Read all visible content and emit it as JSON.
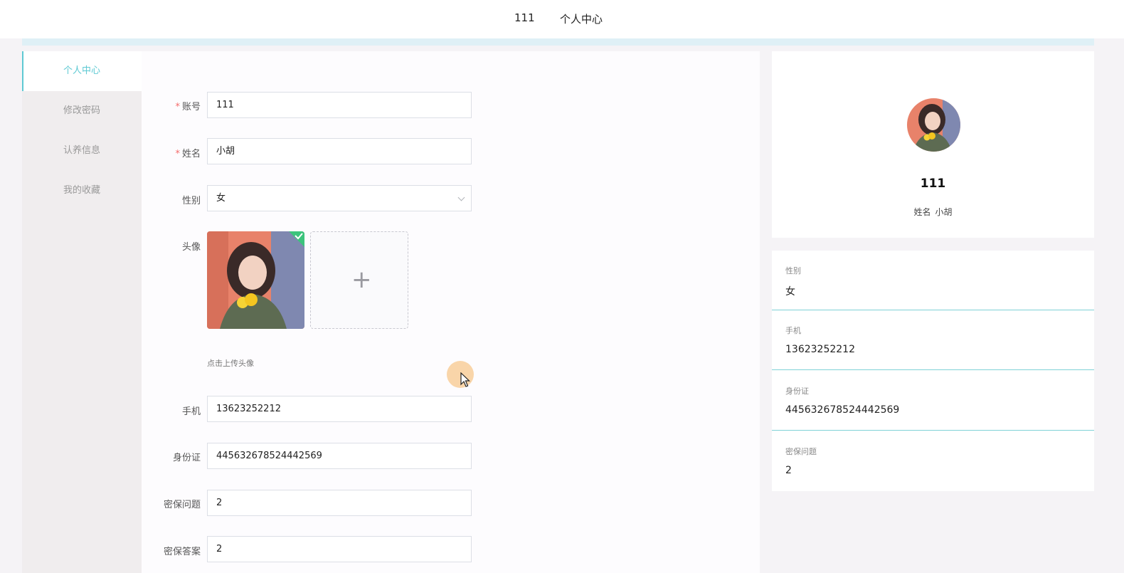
{
  "header": {
    "user": "111",
    "nav_center": "个人中心"
  },
  "sidebar": {
    "items": [
      {
        "label": "个人中心",
        "active": true
      },
      {
        "label": "修改密码",
        "active": false
      },
      {
        "label": "认养信息",
        "active": false
      },
      {
        "label": "我的收藏",
        "active": false
      }
    ]
  },
  "form": {
    "account": {
      "label": "账号",
      "required_mark": "*",
      "value": "111"
    },
    "name": {
      "label": "姓名",
      "required_mark": "*",
      "value": "小胡"
    },
    "gender": {
      "label": "性别",
      "value": "女"
    },
    "avatar": {
      "label": "头像",
      "upload_tip": "点击上传头像",
      "upload_icon": "plus-icon"
    },
    "phone": {
      "label": "手机",
      "value": "13623252212"
    },
    "id_card": {
      "label": "身份证",
      "value": "445632678524442569"
    },
    "security_question": {
      "label": "密保问题",
      "value": "2"
    },
    "security_answer": {
      "label": "密保答案",
      "value": "2"
    }
  },
  "profile": {
    "username": "111",
    "name_label": "姓名",
    "name_value": "小胡"
  },
  "info": [
    {
      "label": "性别",
      "value": "女"
    },
    {
      "label": "手机",
      "value": "13623252212"
    },
    {
      "label": "身份证",
      "value": "445632678524442569"
    },
    {
      "label": "密保问题",
      "value": "2"
    }
  ],
  "colors": {
    "accent": "#5ec9d3",
    "divider": "#7fd2d6",
    "required": "#f56c6c"
  }
}
